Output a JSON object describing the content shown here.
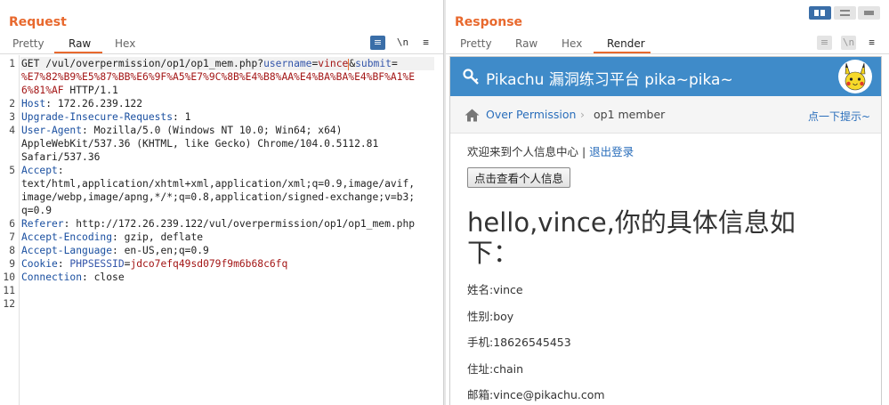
{
  "request": {
    "title": "Request",
    "tabs": [
      "Pretty",
      "Raw",
      "Hex"
    ],
    "active_tab": "Raw",
    "tools": {
      "wrap": "≡",
      "newline": "\\n",
      "menu": "≡"
    },
    "lines": [
      {
        "n": "1",
        "parts": [
          [
            "t",
            "GET /vul/overpermission/op1/op1_mem.php?"
          ],
          [
            "p",
            "username"
          ],
          [
            "t",
            "="
          ],
          [
            "v",
            "vince"
          ],
          [
            "c",
            ""
          ],
          [
            "t",
            "&"
          ],
          [
            "p",
            "submit"
          ],
          [
            "t",
            "="
          ]
        ]
      },
      {
        "n": "",
        "parts": [
          [
            "v",
            "%E7%82%B9%E5%87%BB%E6%9F%A5%E7%9C%8B%E4%B8%AA%E4%BA%BA%E4%BF%A1%E"
          ]
        ]
      },
      {
        "n": "",
        "parts": [
          [
            "v",
            "6%81%AF"
          ],
          [
            "t",
            " HTTP/1.1"
          ]
        ]
      },
      {
        "n": "2",
        "parts": [
          [
            "k",
            "Host"
          ],
          [
            "t",
            ": 172.26.239.122"
          ]
        ]
      },
      {
        "n": "3",
        "parts": [
          [
            "k",
            "Upgrade-Insecure-Requests"
          ],
          [
            "t",
            ": 1"
          ]
        ]
      },
      {
        "n": "4",
        "parts": [
          [
            "k",
            "User-Agent"
          ],
          [
            "t",
            ": Mozilla/5.0 (Windows NT 10.0; Win64; x64)"
          ]
        ]
      },
      {
        "n": "",
        "parts": [
          [
            "t",
            "AppleWebKit/537.36 (KHTML, like Gecko) Chrome/104.0.5112.81"
          ]
        ]
      },
      {
        "n": "",
        "parts": [
          [
            "t",
            "Safari/537.36"
          ]
        ]
      },
      {
        "n": "5",
        "parts": [
          [
            "k",
            "Accept"
          ],
          [
            "t",
            ":"
          ]
        ]
      },
      {
        "n": "",
        "parts": [
          [
            "t",
            "text/html,application/xhtml+xml,application/xml;q=0.9,image/avif,"
          ]
        ]
      },
      {
        "n": "",
        "parts": [
          [
            "t",
            "image/webp,image/apng,*/*;q=0.8,application/signed-exchange;v=b3;"
          ]
        ]
      },
      {
        "n": "",
        "parts": [
          [
            "t",
            "q=0.9"
          ]
        ]
      },
      {
        "n": "6",
        "parts": [
          [
            "k",
            "Referer"
          ],
          [
            "t",
            ": http://172.26.239.122/vul/overpermission/op1/op1_mem.php"
          ]
        ]
      },
      {
        "n": "7",
        "parts": [
          [
            "k",
            "Accept-Encoding"
          ],
          [
            "t",
            ": gzip, deflate"
          ]
        ]
      },
      {
        "n": "8",
        "parts": [
          [
            "k",
            "Accept-Language"
          ],
          [
            "t",
            ": en-US,en;q=0.9"
          ]
        ]
      },
      {
        "n": "9",
        "parts": [
          [
            "k",
            "Cookie"
          ],
          [
            "t",
            ": "
          ],
          [
            "p",
            "PHPSESSID"
          ],
          [
            "t",
            "="
          ],
          [
            "v",
            "jdco7efq49sd079f9m6b68c6fq"
          ]
        ]
      },
      {
        "n": "10",
        "parts": [
          [
            "k",
            "Connection"
          ],
          [
            "t",
            ": close"
          ]
        ]
      },
      {
        "n": "11",
        "parts": []
      },
      {
        "n": "12",
        "parts": []
      }
    ]
  },
  "response": {
    "title": "Response",
    "tabs": [
      "Pretty",
      "Raw",
      "Hex",
      "Render"
    ],
    "active_tab": "Render",
    "tools": {
      "wrap": "≡",
      "newline": "\\n",
      "menu": "≡"
    },
    "render": {
      "site_title": "Pikachu 漏洞练习平台 pika~pika~",
      "breadcrumb_link": "Over Permission",
      "breadcrumb_sep": "›",
      "breadcrumb_current": "op1 member",
      "hint": "点一下提示~",
      "welcome": "欢迎来到个人信息中心 | ",
      "logout": "退出登录",
      "button": "点击查看个人信息",
      "heading": "hello,vince,你的具体信息如下：",
      "fields": [
        "姓名:vince",
        "性别:boy",
        "手机:18626545453",
        "住址:chain",
        "邮箱:vince@pikachu.com"
      ]
    }
  },
  "colors": {
    "accent": "#e8692e",
    "header_blue": "#3f8bc9",
    "link": "#2a6ebb",
    "tool_blue": "#3a6ea8"
  }
}
